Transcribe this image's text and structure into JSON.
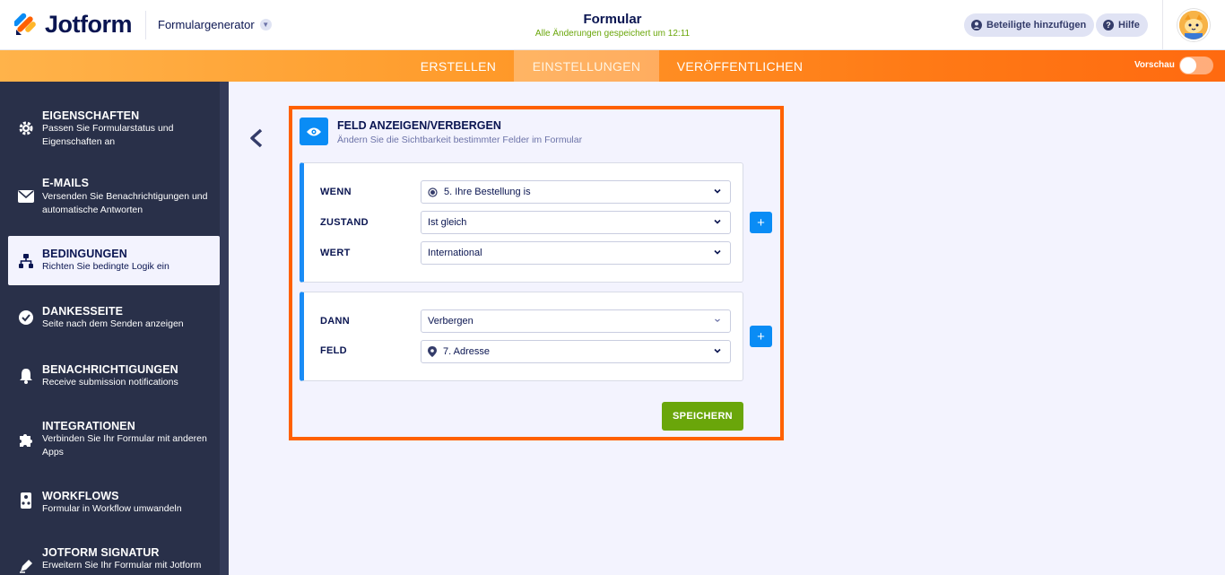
{
  "app": {
    "logo_text": "Jotform",
    "builder_label": "Formulargenerator",
    "form_title": "Formular",
    "save_status": "Alle Änderungen gespeichert um 12:11",
    "add_participants": "Beteiligte hinzufügen",
    "help": "Hilfe"
  },
  "nav": {
    "tabs": [
      {
        "label": "ERSTELLEN",
        "active": false
      },
      {
        "label": "EINSTELLUNGEN",
        "active": true
      },
      {
        "label": "VERÖFFENTLICHEN",
        "active": false
      }
    ],
    "preview_label": "Vorschau",
    "preview_on": false
  },
  "sidebar": {
    "items": [
      {
        "title": "EIGENSCHAFTEN",
        "desc": "Passen Sie Formularstatus und Eigenschaften an",
        "icon": "gear-icon"
      },
      {
        "title": "E-MAILS",
        "desc": "Versenden Sie Benachrichtigungen und automatische Antworten",
        "icon": "envelope-icon"
      },
      {
        "title": "BEDINGUNGEN",
        "desc": "Richten Sie bedingte Logik ein",
        "icon": "sitemap-icon",
        "active": true
      },
      {
        "title": "DANKESSEITE",
        "desc": "Seite nach dem Senden anzeigen",
        "icon": "check-circle-icon"
      },
      {
        "title": "BENACHRICHTIGUNGEN",
        "desc": "Receive submission notifications",
        "icon": "bell-icon"
      },
      {
        "title": "INTEGRATIONEN",
        "desc": "Verbinden Sie Ihr Formular mit anderen Apps",
        "icon": "puzzle-icon"
      },
      {
        "title": "WORKFLOWS",
        "desc": "Formular in Workflow umwandeln",
        "icon": "workflow-icon"
      },
      {
        "title": "JOTFORM SIGNATUR",
        "desc": "Erweitern Sie Ihr Formular mit Jotform",
        "icon": "pen-icon"
      }
    ]
  },
  "condition": {
    "title": "FELD ANZEIGEN/VERBERGEN",
    "subtitle": "Ändern Sie die Sichtbarkeit bestimmter Felder im Formular",
    "if_label": "WENN",
    "if_value": "5. Ihre Bestellung is",
    "state_label": "ZUSTAND",
    "state_value": "Ist gleich",
    "value_label": "WERT",
    "value_value": "International",
    "then_label": "DANN",
    "then_value": "Verbergen",
    "field_label": "FELD",
    "field_value": "7. Adresse",
    "save_label": "SPEICHERN",
    "plus_symbol": "+"
  },
  "colors": {
    "accent_orange": "#ff6100",
    "blue": "#0a8cf5",
    "green": "#6aa60a",
    "sidebar_bg": "#293049",
    "navy_text": "#0a1551"
  }
}
